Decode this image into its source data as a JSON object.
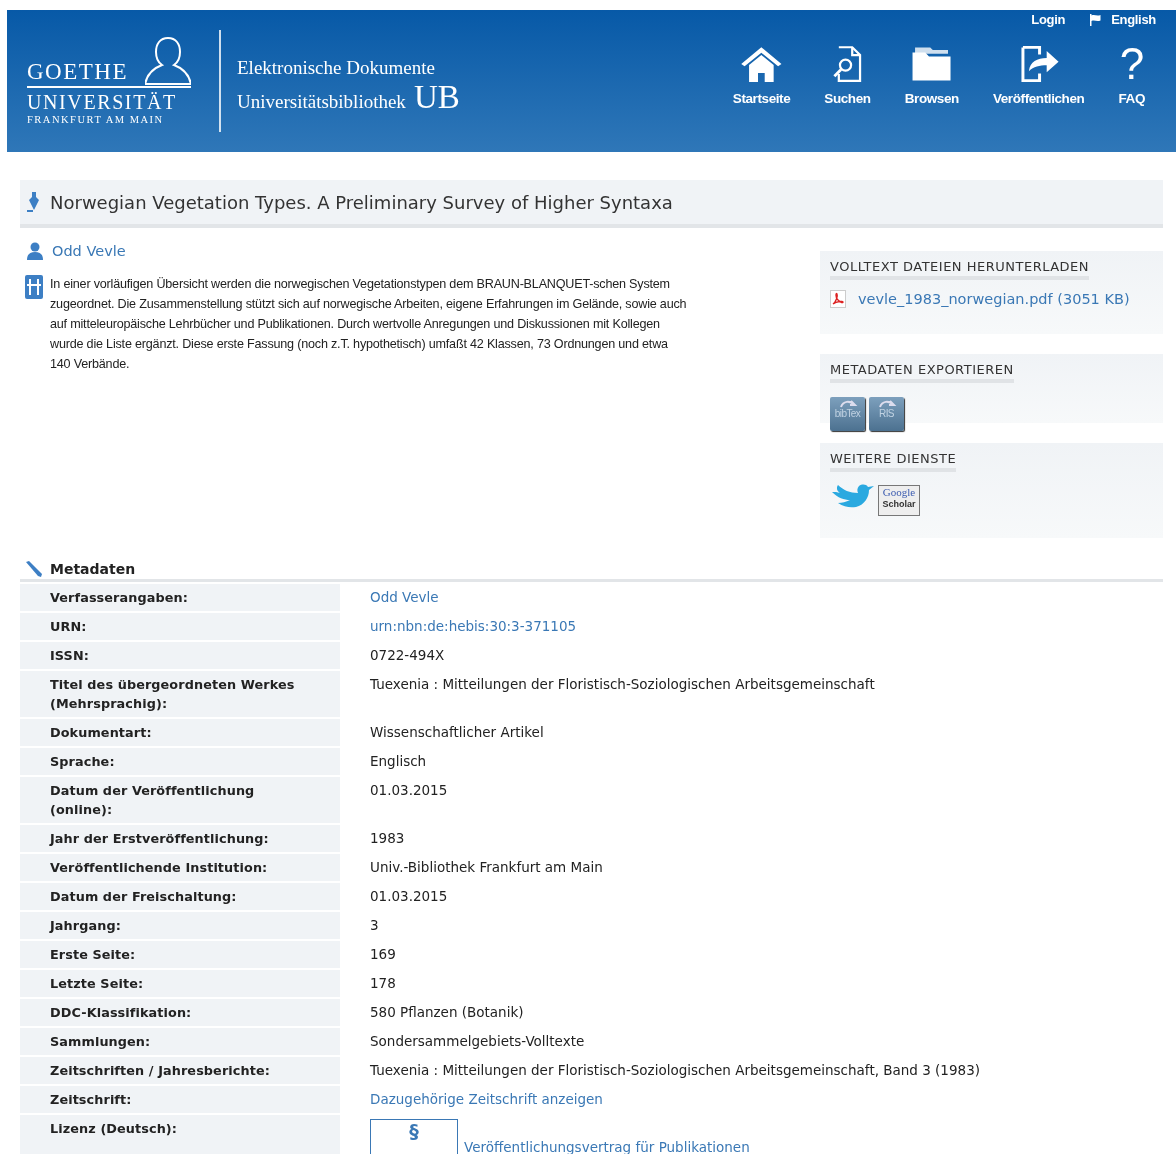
{
  "header": {
    "logo": {
      "line_1": "GOETHE",
      "line_2": "UNIVERSITÄT",
      "line_3": "FRANKFURT AM MAIN"
    },
    "site": {
      "line_1": "Elektronische Dokumente",
      "line_2": "Universitätsbibliothek",
      "mark": "UB"
    },
    "top_links": [
      {
        "label": "Login",
        "kind": "text"
      },
      {
        "label": "English",
        "kind": "flag"
      }
    ],
    "nav": [
      {
        "label": "Startseite",
        "kind": "home"
      },
      {
        "label": "Suchen",
        "kind": "search"
      },
      {
        "label": "Browsen",
        "kind": "folder"
      },
      {
        "label": "Veröffentlichen",
        "kind": "publish"
      },
      {
        "label": "FAQ",
        "kind": "help",
        "glyph": "?"
      }
    ]
  },
  "document": {
    "title": "Norwegian Vegetation Types. A Preliminary Survey of Higher Syntaxa",
    "author": "Odd Vevle",
    "abstract": "In einer vorläufigen Übersicht werden die norwegischen Vegetationstypen dem BRAUN-BLANQUET-schen System zugeordnet. Die Zusammenstellung stützt sich auf norwegische Arbeiten, eigene Erfahrungen im Gelände, sowie auch auf mitteleuropäische Lehrbücher und Publikationen. Durch wertvolle Anregungen und Diskussionen mit Kollegen wurde die Liste ergänzt. Diese erste Fassung (noch z.T. hypothetisch) umfaßt 42 Klassen, 73 Ordnungen und etwa 140 Verbände."
  },
  "sidebar": [
    {
      "heading": "VOLLTEXT DATEIEN HERUNTERLADEN",
      "kind": "files",
      "files": [
        "vevle_1983_norwegian.pdf (3051 KB)"
      ]
    },
    {
      "heading": "METADATEN EXPORTIEREN",
      "kind": "export",
      "buttons": [
        "bibTex",
        "RIS"
      ]
    },
    {
      "heading": "WEITERE DIENSTE",
      "kind": "services",
      "services": [
        {
          "kind": "bird"
        },
        {
          "kind": "scholar",
          "label_1": "Google",
          "label_2": "Scholar"
        }
      ]
    }
  ],
  "metadata": {
    "heading": "Metadaten",
    "rows": [
      {
        "label": "Verfasserangaben:",
        "value": "Odd Vevle",
        "kind": "link"
      },
      {
        "label": "URN:",
        "value": "urn:nbn:de:hebis:30:3-371105",
        "kind": "link"
      },
      {
        "label": "ISSN:",
        "value": "0722-494X",
        "kind": "text"
      },
      {
        "label": "Titel des übergeordneten Werkes (Mehrsprachig):",
        "value": "Tuexenia : Mitteilungen der Floristisch-Soziologischen Arbeitsgemeinschaft",
        "kind": "text"
      },
      {
        "label": "Dokumentart:",
        "value": "Wissenschaftlicher Artikel",
        "kind": "text"
      },
      {
        "label": "Sprache:",
        "value": "Englisch",
        "kind": "text"
      },
      {
        "label": "Datum der Veröffentlichung (online):",
        "value": "01.03.2015",
        "kind": "text"
      },
      {
        "label": "Jahr der Erstveröffentlichung:",
        "value": "1983",
        "kind": "text"
      },
      {
        "label": "Veröffentlichende Institution:",
        "value": "Univ.-Bibliothek Frankfurt am Main",
        "kind": "text"
      },
      {
        "label": "Datum der Freischaltung:",
        "value": "01.03.2015",
        "kind": "text"
      },
      {
        "label": "Jahrgang:",
        "value": "3",
        "kind": "text"
      },
      {
        "label": "Erste Seite:",
        "value": "169",
        "kind": "text"
      },
      {
        "label": "Letzte Seite:",
        "value": "178",
        "kind": "text"
      },
      {
        "label": "DDC-Klassifikation:",
        "value": "580 Pflanzen (Botanik)",
        "kind": "text"
      },
      {
        "label": "Sammlungen:",
        "value": "Sondersammelgebiets-Volltexte",
        "kind": "text"
      },
      {
        "label": "Zeitschriften / Jahresberichte:",
        "value": "Tuexenia : Mitteilungen der Floristisch-Soziologischen Arbeitsgemeinschaft, Band 3 (1983)",
        "kind": "text"
      },
      {
        "label": "Zeitschrift:",
        "value": "Dazugehörige Zeitschrift anzeigen",
        "kind": "link"
      },
      {
        "label": "Lizenz (Deutsch):",
        "value": "Veröffentlichungsvertrag für Publikationen",
        "kind": "license",
        "badge": "§"
      }
    ]
  }
}
